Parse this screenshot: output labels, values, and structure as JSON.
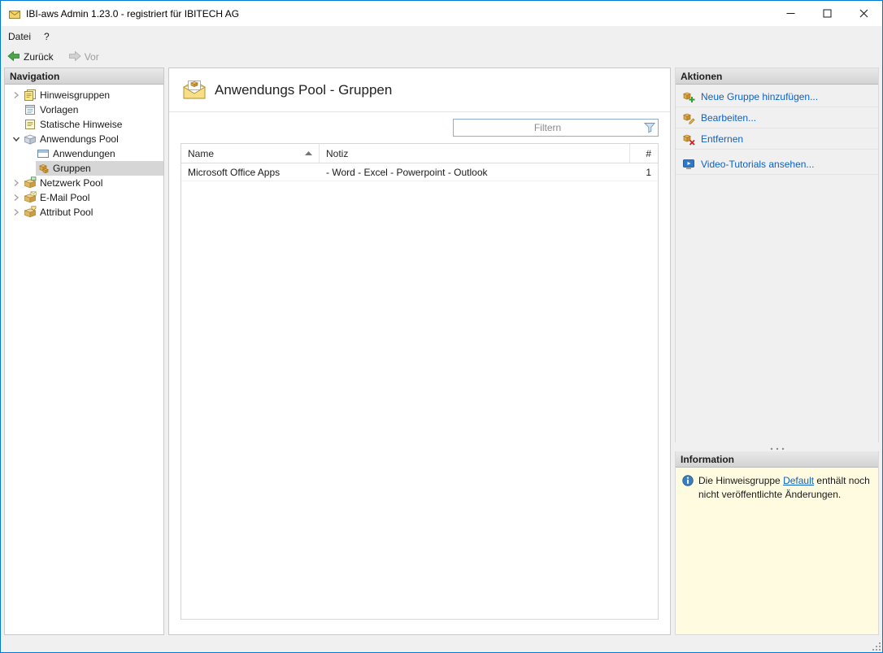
{
  "window": {
    "title": "IBI-aws Admin 1.23.0 - registriert für IBITECH AG"
  },
  "menubar": {
    "items": [
      {
        "label": "Datei"
      },
      {
        "label": "?"
      }
    ]
  },
  "toolbar": {
    "back_label": "Zurück",
    "forward_label": "Vor"
  },
  "navigation": {
    "header": "Navigation",
    "items": [
      {
        "label": "Hinweisgruppen"
      },
      {
        "label": "Vorlagen"
      },
      {
        "label": "Statische Hinweise"
      },
      {
        "label": "Anwendungs Pool"
      },
      {
        "label": "Anwendungen"
      },
      {
        "label": "Gruppen"
      },
      {
        "label": "Netzwerk Pool"
      },
      {
        "label": "E-Mail Pool"
      },
      {
        "label": "Attribut Pool"
      }
    ]
  },
  "main": {
    "title": "Anwendungs Pool - Gruppen",
    "filter": {
      "placeholder": "Filtern"
    },
    "table": {
      "columns": [
        {
          "label": "Name"
        },
        {
          "label": "Notiz"
        },
        {
          "label": "#"
        }
      ],
      "rows": [
        {
          "name": "Microsoft Office Apps",
          "notiz": "- Word - Excel - Powerpoint - Outlook",
          "count": "1"
        }
      ]
    }
  },
  "actions": {
    "header": "Aktionen",
    "items": [
      {
        "label": "Neue Gruppe hinzufügen..."
      },
      {
        "label": "Bearbeiten..."
      },
      {
        "label": "Entfernen"
      },
      {
        "label": "Video-Tutorials ansehen..."
      }
    ]
  },
  "information": {
    "header": "Information",
    "text_before": "Die Hinweisgruppe ",
    "link_text": "Default",
    "text_after": " enthält noch nicht veröffentlichte Änderungen."
  },
  "icons": {
    "app": "app-icon",
    "back": "back-arrow-icon",
    "forward": "forward-arrow-icon",
    "filter": "funnel-icon",
    "sort": "sort-ascending-icon",
    "info": "info-icon"
  },
  "colors": {
    "accent_border": "#0078d7",
    "link_blue": "#0b62c4",
    "info_background": "#fffbe1",
    "selection_gray": "#d6d6d6",
    "chrome_gray": "#f0f0f0"
  }
}
